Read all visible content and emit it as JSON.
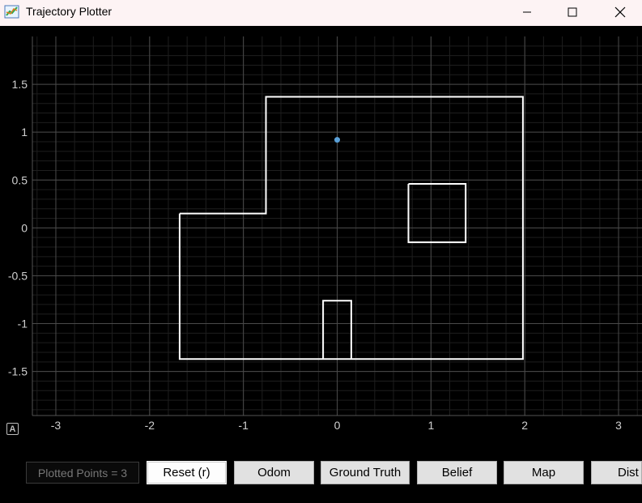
{
  "window": {
    "title": "Trajectory Plotter",
    "minimize_glyph": "—",
    "maximize_glyph": "☐",
    "close_glyph": "✕"
  },
  "icons": {
    "app": "chart-line-icon",
    "autoscale": "A"
  },
  "plot": {
    "x_range": [
      -3.25,
      3.25
    ],
    "y_range": [
      -1.96,
      2.0
    ],
    "x_ticks": [
      "-3",
      "-2",
      "-1",
      "0",
      "1",
      "2",
      "3"
    ],
    "y_ticks": [
      "1.5",
      "1",
      "0.5",
      "0",
      "-0.5",
      "-1",
      "-1.5"
    ],
    "colors": {
      "background": "#000000",
      "grid_major": "#4a4a4a",
      "grid_minor": "#1e1e1e",
      "map": "#ffffff",
      "point": "#5aa0d8"
    }
  },
  "chart_data": {
    "type": "scatter",
    "x_range": [
      -3.25,
      3.25
    ],
    "y_range": [
      -1.96,
      2.0
    ],
    "grid": true,
    "points": [
      {
        "x": 0.0,
        "y": 0.92
      }
    ],
    "map_segments": [
      {
        "x": [
          -1.68,
          -0.76,
          -0.76,
          1.98,
          1.98,
          -1.68,
          -1.68
        ],
        "y": [
          0.15,
          0.15,
          1.37,
          1.37,
          -1.37,
          -1.37,
          0.15
        ]
      },
      {
        "x": [
          0.76,
          1.37,
          1.37,
          0.76,
          0.76
        ],
        "y": [
          0.46,
          0.46,
          -0.15,
          -0.15,
          0.46
        ]
      },
      {
        "x": [
          -0.15,
          -0.15,
          0.15,
          0.15
        ],
        "y": [
          -1.37,
          -0.76,
          -0.76,
          -1.37
        ]
      }
    ]
  },
  "status": {
    "plotted_points": "Plotted Points = 3"
  },
  "buttons": [
    {
      "label": "Reset (r)"
    },
    {
      "label": "Odom"
    },
    {
      "label": "Ground Truth"
    },
    {
      "label": "Belief"
    },
    {
      "label": "Map"
    },
    {
      "label": "Dist"
    }
  ]
}
